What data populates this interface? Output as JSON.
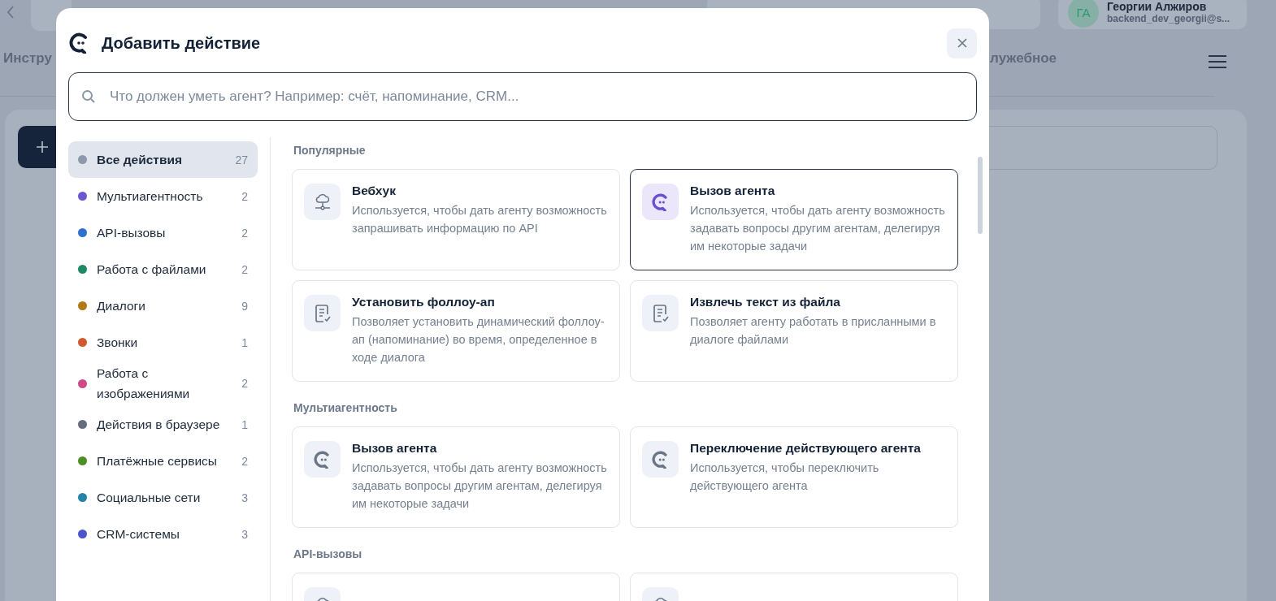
{
  "background": {
    "tab_left": "Инстру",
    "tab_right": "лужебное",
    "user": {
      "initials": "ГА",
      "name": "Георгии Алжиров",
      "email": "backend_dev_georgii@s..."
    }
  },
  "dialog": {
    "title": "Добавить действие",
    "search": {
      "placeholder": "Что должен уметь агент? Например: счёт, напоминание, CRM..."
    },
    "categories": [
      {
        "label": "Все действия",
        "count": "27",
        "color": "#8d99ab",
        "selected": true
      },
      {
        "label": "Мультиагентность",
        "count": "2",
        "color": "#6b57d2",
        "selected": false
      },
      {
        "label": "API-вызовы",
        "count": "2",
        "color": "#2f6fcf",
        "selected": false
      },
      {
        "label": "Работа с файлами",
        "count": "2",
        "color": "#1e8a64",
        "selected": false
      },
      {
        "label": "Диалоги",
        "count": "9",
        "color": "#b07a16",
        "selected": false
      },
      {
        "label": "Звонки",
        "count": "1",
        "color": "#cf5a30",
        "selected": false
      },
      {
        "label": "Работа с изображениями",
        "count": "2",
        "color": "#cf4a86",
        "selected": false
      },
      {
        "label": "Действия в браузере",
        "count": "1",
        "color": "#656d7d",
        "selected": false
      },
      {
        "label": "Платёжные сервисы",
        "count": "2",
        "color": "#4e8f25",
        "selected": false
      },
      {
        "label": "Социальные сети",
        "count": "3",
        "color": "#2384a8",
        "selected": false
      },
      {
        "label": "CRM-системы",
        "count": "3",
        "color": "#4b55cc",
        "selected": false
      }
    ],
    "sections": [
      {
        "title": "Популярные",
        "cards": [
          {
            "kind": "webhook",
            "title": "Вебхук",
            "description": "Используется, чтобы дать агенту возможность запрашивать информацию по API",
            "selected": false
          },
          {
            "kind": "agent",
            "title": "Вызов агента",
            "description": "Используется, чтобы дать агенту возможность задавать вопросы другим агентам, делегируя им некоторые задачи",
            "selected": true
          },
          {
            "kind": "document",
            "title": "Установить фоллоу-ап",
            "description": "Позволяет установить динамический фоллоу-ап (напоминание) во время, определенное в ходе диалога",
            "selected": false
          },
          {
            "kind": "document",
            "title": "Извлечь текст из файла",
            "description": "Позволяет агенту работать в присланными в диалоге файлами",
            "selected": false
          }
        ]
      },
      {
        "title": "Мультиагентность",
        "cards": [
          {
            "kind": "agent",
            "title": "Вызов агента",
            "description": "Используется, чтобы дать агенту возможность задавать вопросы другим агентам, делегируя им некоторые задачи",
            "selected": false
          },
          {
            "kind": "agent",
            "title": "Переключение действующего агента",
            "description": "Используется, чтобы переключить действующего агента",
            "selected": false
          }
        ]
      },
      {
        "title": "API-вызовы",
        "cards": [
          {
            "kind": "webhook",
            "selected": false
          },
          {
            "kind": "webhook",
            "selected": false
          }
        ]
      }
    ]
  }
}
